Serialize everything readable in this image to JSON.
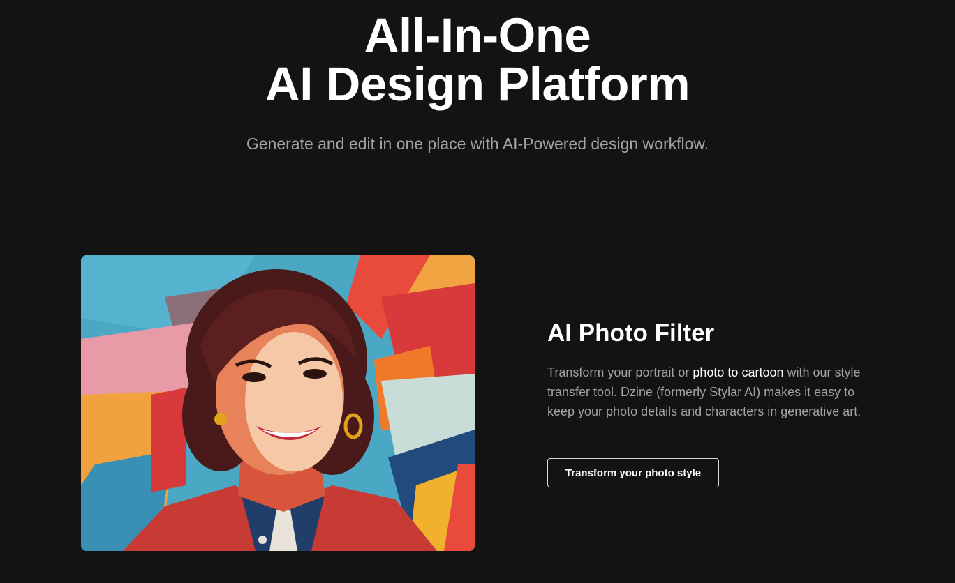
{
  "hero": {
    "title_line1": "All-In-One",
    "title_line2": "AI Design Platform",
    "subtitle": "Generate and edit in one place with AI-Powered design workflow."
  },
  "feature": {
    "image_description_icon": "cartoon-portrait-image",
    "title": "AI Photo Filter",
    "description_part1": "Transform your portrait or ",
    "description_link": "photo to cartoon",
    "description_part2": " with our style transfer tool. Dzine (formerly Stylar AI) makes it easy to keep your photo details and characters in generative art.",
    "cta_label": "Transform your photo style"
  },
  "colors": {
    "background": "#131313",
    "heading": "#ffffff",
    "body_text": "#a3a3a3",
    "button_border": "#d9d9d9"
  }
}
